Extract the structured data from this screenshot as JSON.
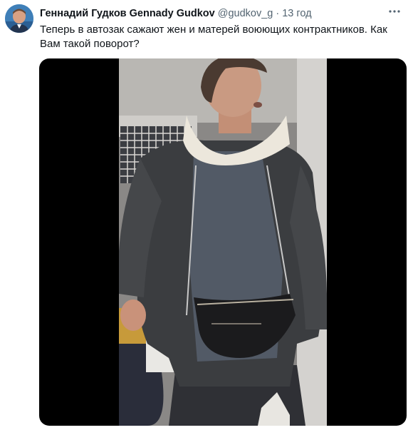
{
  "tweet": {
    "author_name": "Геннадий Гудков Gennady Gudkov",
    "handle": "@gudkov_g",
    "separator": "·",
    "time": "13 год",
    "more_icon": "more-horizontal-icon",
    "text": "Теперь в автозак сажают жен и матерей воюющих контрактников. Как Вам такой поворот?"
  },
  "colors": {
    "name": "#0f1419",
    "secondary": "#536471",
    "media_bg": "#000000"
  }
}
